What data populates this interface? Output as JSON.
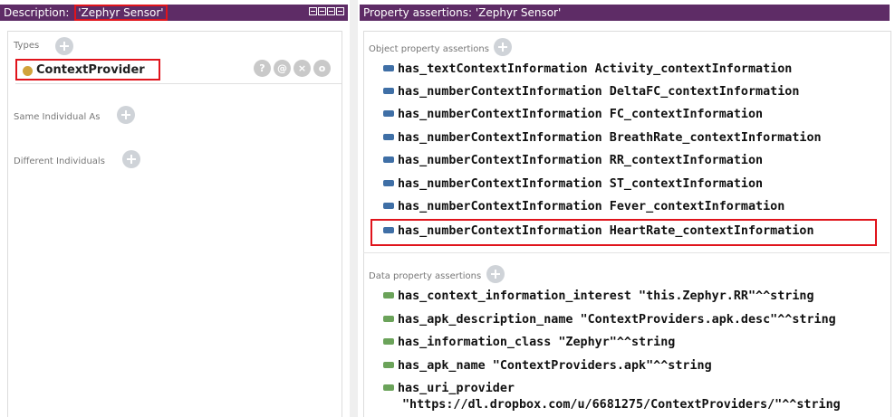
{
  "left_panel": {
    "title_prefix": "Description: ",
    "title_entity": "'Zephyr Sensor'",
    "types_label": "Types",
    "type_class": "ContextProvider",
    "type_actions": [
      "?",
      "@",
      "×",
      "o"
    ],
    "same_individual_label": "Same Individual As",
    "different_individuals_label": "Different Individuals"
  },
  "right_panel": {
    "title": "Property assertions: 'Zephyr Sensor'",
    "object_header": "Object property assertions",
    "object_assertions": [
      "has_textContextInformation  Activity_contextInformation",
      "has_numberContextInformation  DeltaFC_contextInformation",
      "has_numberContextInformation  FC_contextInformation",
      "has_numberContextInformation  BreathRate_contextInformation",
      "has_numberContextInformation  RR_contextInformation",
      "has_numberContextInformation  ST_contextInformation",
      "has_numberContextInformation  Fever_contextInformation",
      "has_numberContextInformation  HeartRate_contextInformation"
    ],
    "data_header": "Data property assertions",
    "data_assertions": [
      "has_context_information_interest  \"this.Zephyr.RR\"^^string",
      "has_apk_description_name  \"ContextProviders.apk.desc\"^^string",
      "has_information_class  \"Zephyr\"^^string",
      "has_apk_name  \"ContextProviders.apk\"^^string",
      "has_uri_provider"
    ],
    "data_assertion_continuation": "\"https://dl.dropbox.com/u/6681275/ContextProviders/\"^^string"
  },
  "colors": {
    "title_bar": "#5e2c66",
    "highlight": "#e0141c",
    "class_dot": "#d1a33b",
    "object_property_icon": "#3f6fa6",
    "data_property_icon": "#6ba35a"
  },
  "icons": {
    "class": "class-dot-icon",
    "object_property": "object-property-icon",
    "data_property": "data-property-icon",
    "add": "add-icon"
  }
}
